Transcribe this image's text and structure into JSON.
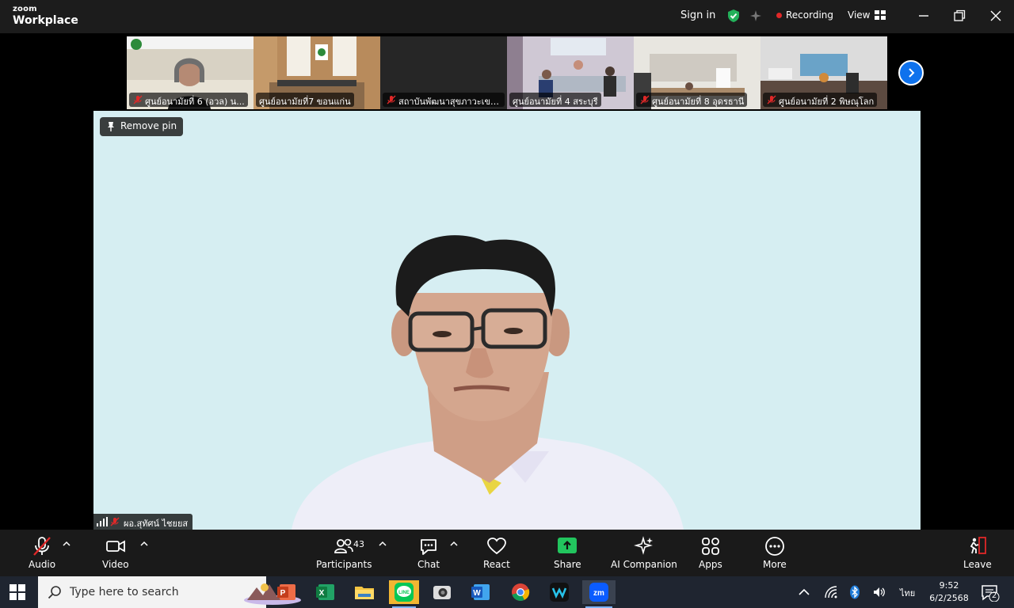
{
  "window": {
    "brand_small": "zoom",
    "brand_large": "Workplace",
    "sign_in": "Sign in",
    "recording": "Recording",
    "view": "View"
  },
  "thumbnails": [
    {
      "label": "ศูนย์อนามัยที่ 6 (อวล) น...",
      "muted": true
    },
    {
      "label": "ศูนย์อนามัยที่7 ขอนแก่น",
      "muted": false
    },
    {
      "label": "สถาบันพัฒนาสุขภาวะเขต...",
      "muted": true
    },
    {
      "label": "ศูนย์อนามัยที่ 4 สระบุรี",
      "muted": false
    },
    {
      "label": "ศูนย์อนามัยที่ 8 อุดรธานี",
      "muted": true
    },
    {
      "label": "ศูนย์อนามัยที่ 2 พิษณุโลก",
      "muted": true
    }
  ],
  "main": {
    "remove_pin": "Remove pin",
    "speaker_name": "ผอ.สุทัศน์ ไชยยส"
  },
  "toolbar": {
    "audio": "Audio",
    "video": "Video",
    "participants": "Participants",
    "participant_count": "43",
    "chat": "Chat",
    "react": "React",
    "share": "Share",
    "ai_companion": "AI Companion",
    "apps": "Apps",
    "more": "More",
    "leave": "Leave"
  },
  "taskbar": {
    "search_placeholder": "Type here to search",
    "language": "ไทย",
    "time": "9:52",
    "date": "6/2/2568",
    "notification_count": "2"
  },
  "colors": {
    "share_green": "#22c55e",
    "accent_blue": "#0e72ed",
    "mute_red": "#e02828"
  }
}
